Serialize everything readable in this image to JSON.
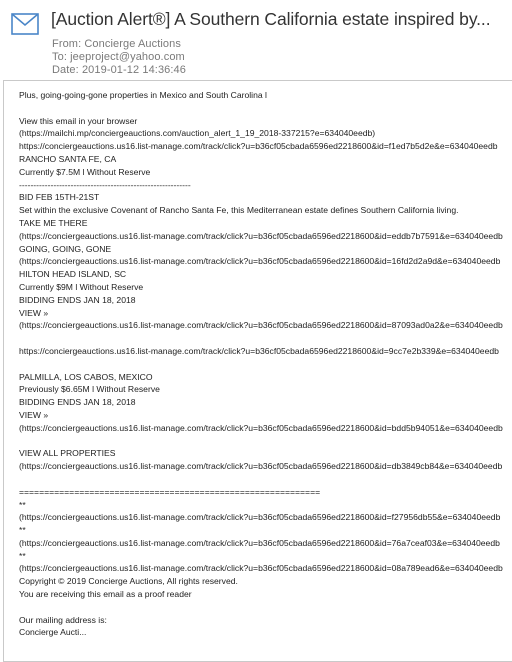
{
  "email": {
    "subject": "[Auction Alert®] A Southern California estate inspired by...",
    "from": "From: Concierge Auctions",
    "to": "To: jeeproject@yahoo.com",
    "date": "Date: 2019-01-12 14:36:46"
  },
  "body": {
    "lines": [
      "Plus, going-going-gone properties in Mexico and South Carolina l",
      "",
      "View this email in your browser",
      "(https://mailchi.mp/conciergeauctions.com/auction_alert_1_19_2018-337215?e=634040eedb)",
      "https://conciergeauctions.us16.list-manage.com/track/click?u=b36cf05cbada6596ed2218600&id=f1ed7b5d2e&e=634040eedb",
      "RANCHO SANTA FE, CA",
      "Currently $7.5M l Without Reserve",
      "------------------------------------------------------------",
      "BID FEB 15TH-21ST",
      "Set within the exclusive Covenant of Rancho Santa Fe, this Mediterranean estate defines Southern California living.",
      "TAKE ME THERE",
      "(https://conciergeauctions.us16.list-manage.com/track/click?u=b36cf05cbada6596ed2218600&id=eddb7b7591&e=634040eedb",
      "GOING, GOING, GONE",
      "(https://conciergeauctions.us16.list-manage.com/track/click?u=b36cf05cbada6596ed2218600&id=16fd2d2a9d&e=634040eedb",
      "HILTON HEAD ISLAND, SC",
      "Currently $9M l Without Reserve",
      "BIDDING ENDS JAN 18, 2018",
      "VIEW »",
      "(https://conciergeauctions.us16.list-manage.com/track/click?u=b36cf05cbada6596ed2218600&id=87093ad0a2&e=634040eedb",
      "",
      "https://conciergeauctions.us16.list-manage.com/track/click?u=b36cf05cbada6596ed2218600&id=9cc7e2b339&e=634040eedb",
      "",
      "PALMILLA, LOS CABOS, MEXICO",
      "Previously $6.65M l Without Reserve",
      "BIDDING ENDS JAN 18, 2018",
      "VIEW »",
      "(https://conciergeauctions.us16.list-manage.com/track/click?u=b36cf05cbada6596ed2218600&id=bdd5b94051&e=634040eedb",
      "",
      "VIEW ALL PROPERTIES",
      "(https://conciergeauctions.us16.list-manage.com/track/click?u=b36cf05cbada6596ed2218600&id=db3849cb84&e=634040eedb",
      "",
      "============================================================",
      "**",
      "(https://conciergeauctions.us16.list-manage.com/track/click?u=b36cf05cbada6596ed2218600&id=f27956db55&e=634040eedb",
      "**",
      "(https://conciergeauctions.us16.list-manage.com/track/click?u=b36cf05cbada6596ed2218600&id=76a7ceaf03&e=634040eedb",
      "**",
      "(https://conciergeauctions.us16.list-manage.com/track/click?u=b36cf05cbada6596ed2218600&id=08a789ead6&e=634040eedb",
      "Copyright © 2019 Concierge Auctions, All rights reserved.",
      "You are receiving this email as a proof reader",
      "",
      "Our mailing address is:",
      "Concierge Aucti..."
    ]
  },
  "colors": {
    "icon": "#4a86c8",
    "subject": "#333333",
    "meta": "#7a7a7a",
    "panel_border": "#c9c9c9",
    "body_text": "#222222"
  },
  "icons": {
    "envelope": "envelope-icon"
  }
}
